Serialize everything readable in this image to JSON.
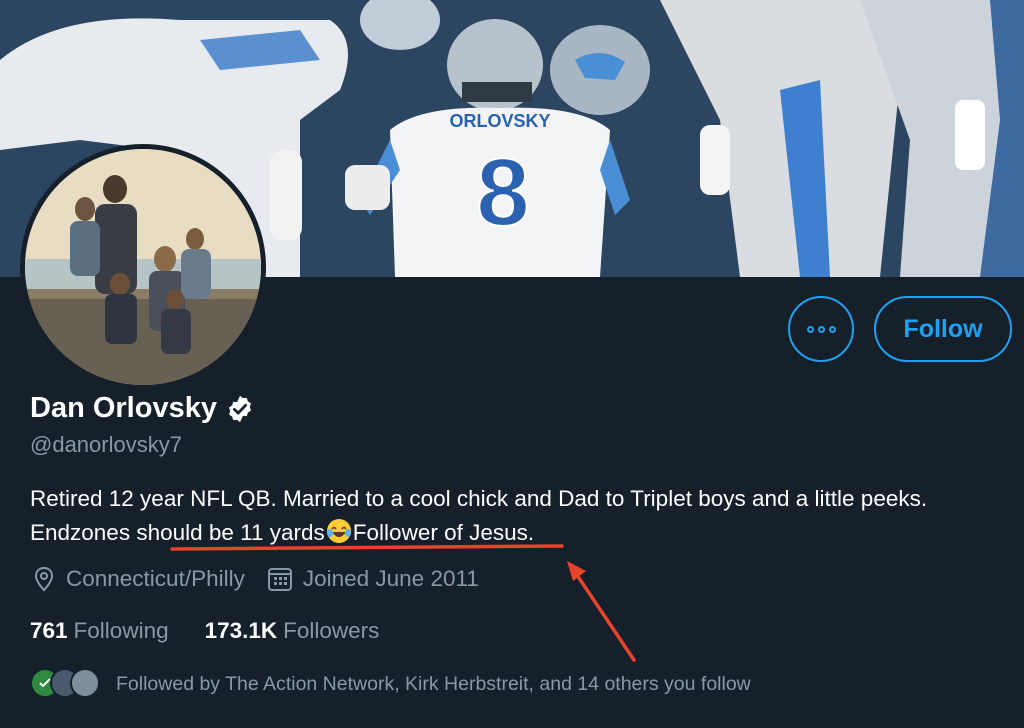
{
  "banner": {
    "jersey_name": "ORLOVSKY",
    "jersey_number": "8"
  },
  "profile": {
    "name": "Dan Orlovsky",
    "handle": "@danorlovsky7",
    "bio_part1": "Retired 12 year NFL QB. Married to a cool chick and Dad to Triplet boys and a little peeks. ",
    "bio_highlight": "Endzones should be 11 yards",
    "bio_emoji": "tears-of-joy-emoji",
    "bio_part2": "Follower of Jesus.",
    "location": "Connecticut/Philly",
    "joined": "Joined June 2011"
  },
  "stats": {
    "following_count": "761",
    "following_label": "Following",
    "followers_count": "173.1K",
    "followers_label": "Followers"
  },
  "followed_by": {
    "text": "Followed by The Action Network, Kirk Herbstreit, and 14 others you follow"
  },
  "actions": {
    "follow_label": "Follow",
    "more_icon": "more-horizontal-icon"
  },
  "colors": {
    "background": "#15202b",
    "accent": "#1da1f2",
    "muted": "#8899a6",
    "annotation": "#e8442c"
  }
}
